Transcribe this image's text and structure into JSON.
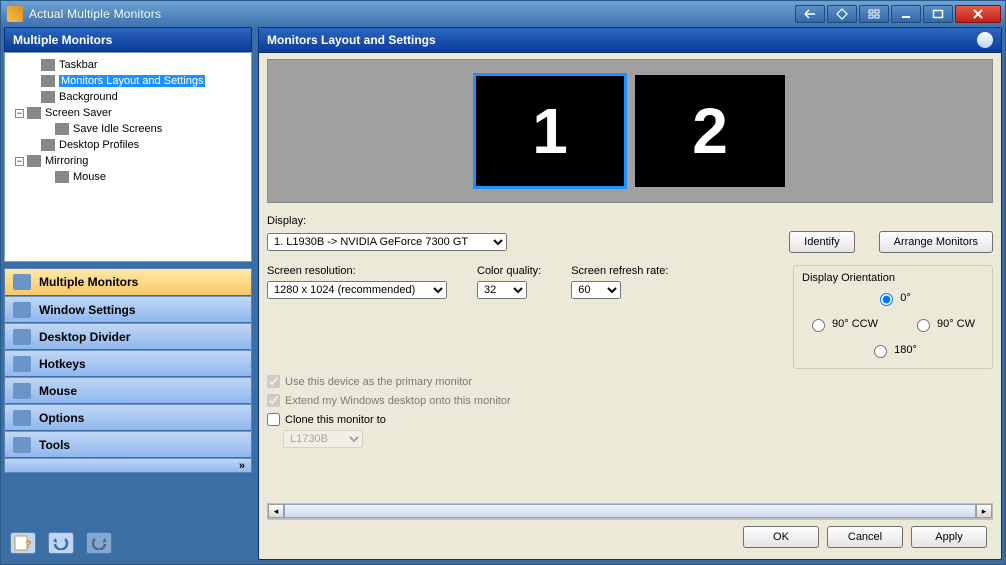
{
  "window": {
    "title": "Actual Multiple Monitors"
  },
  "left_panel": {
    "title": "Multiple Monitors"
  },
  "tree": {
    "items": [
      {
        "indent": 1,
        "exp": "",
        "label": "Taskbar"
      },
      {
        "indent": 1,
        "exp": "",
        "label": "Monitors Layout and Settings",
        "selected": true
      },
      {
        "indent": 1,
        "exp": "",
        "label": "Background"
      },
      {
        "indent": 0,
        "exp": "−",
        "label": "Screen Saver"
      },
      {
        "indent": 2,
        "exp": "",
        "label": "Save Idle Screens"
      },
      {
        "indent": 1,
        "exp": "",
        "label": "Desktop Profiles"
      },
      {
        "indent": 0,
        "exp": "−",
        "label": "Mirroring"
      },
      {
        "indent": 2,
        "exp": "",
        "label": "Mouse"
      }
    ]
  },
  "nav": {
    "items": [
      {
        "label": "Multiple Monitors",
        "active": true
      },
      {
        "label": "Window Settings"
      },
      {
        "label": "Desktop Divider"
      },
      {
        "label": "Hotkeys"
      },
      {
        "label": "Mouse"
      },
      {
        "label": "Options"
      },
      {
        "label": "Tools"
      }
    ],
    "expand_glyph": "»"
  },
  "right_panel": {
    "title": "Monitors Layout and Settings"
  },
  "monitors": {
    "m1": "1",
    "m2": "2"
  },
  "form": {
    "display_label": "Display:",
    "display_value": "1. L1930B -> NVIDIA GeForce 7300 GT",
    "identify_btn": "Identify",
    "arrange_btn": "Arrange Monitors",
    "res_label": "Screen resolution:",
    "res_value": "1280 x 1024 (recommended)",
    "color_label": "Color quality:",
    "color_value": "32",
    "refresh_label": "Screen refresh rate:",
    "refresh_value": "60",
    "orient_label": "Display Orientation",
    "orient_0": "0°",
    "orient_90ccw": "90° CCW",
    "orient_90cw": "90° CW",
    "orient_180": "180°",
    "cb_primary": "Use this device as the primary monitor",
    "cb_extend": "Extend my Windows desktop onto this monitor",
    "cb_clone": "Clone this monitor to",
    "clone_target": "L1730B"
  },
  "footer": {
    "ok": "OK",
    "cancel": "Cancel",
    "apply": "Apply"
  }
}
